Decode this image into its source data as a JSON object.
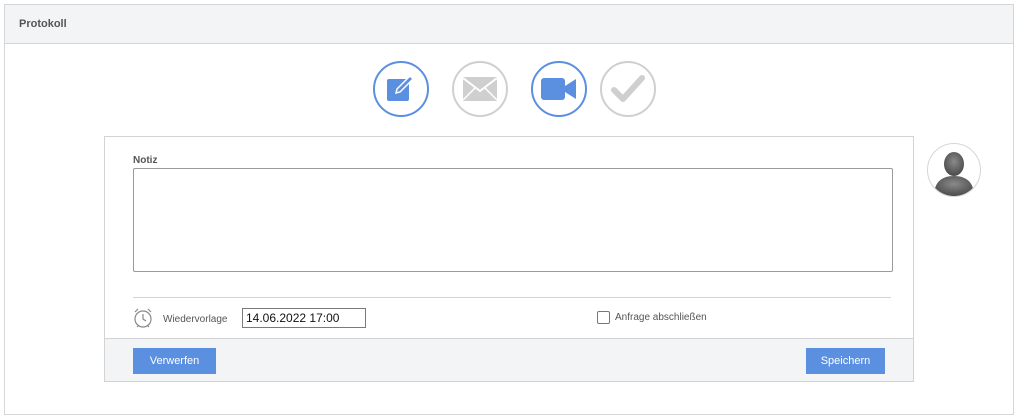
{
  "header": {
    "title": "Protokoll"
  },
  "type_buttons": [
    {
      "icon": "edit-icon",
      "state": "active"
    },
    {
      "icon": "envelope-icon",
      "state": "inactive"
    },
    {
      "icon": "video-camera-icon",
      "state": "active"
    },
    {
      "icon": "checkmark-icon",
      "state": "inactive"
    }
  ],
  "form": {
    "note_label": "Notiz",
    "note_value": "",
    "followup_label": "Wiedervorlage",
    "followup_value": "14.06.2022 17:00",
    "close_request_label": "Anfrage abschließen",
    "close_request_checked": false
  },
  "footer": {
    "discard_label": "Verwerfen",
    "save_label": "Speichern"
  },
  "colors": {
    "accent": "#5b8fe0",
    "inactive": "#cfcfcf",
    "header_bg": "#f3f4f6"
  }
}
